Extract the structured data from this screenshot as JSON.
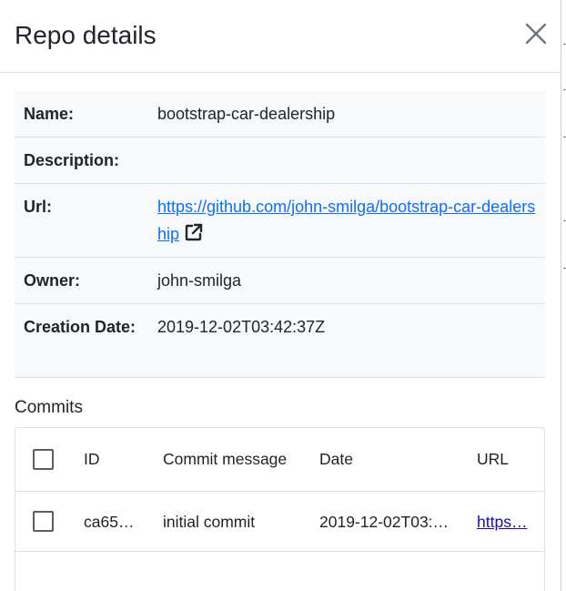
{
  "modal": {
    "title": "Repo details",
    "close_icon": "close-icon"
  },
  "details": {
    "name": {
      "label": "Name:",
      "value": "bootstrap-car-dealership"
    },
    "description": {
      "label": "Description:",
      "value": ""
    },
    "url": {
      "label": "Url:",
      "value": "https://github.com/john-smilga/bootstrap-car-dealership",
      "icon": "external-link-icon"
    },
    "owner": {
      "label": "Owner:",
      "value": "john-smilga"
    },
    "creation_date": {
      "label": "Creation Date:",
      "value": "2019-12-02T03:42:37Z"
    }
  },
  "commits": {
    "title": "Commits",
    "columns": [
      "ID",
      "Commit message",
      "Date",
      "URL"
    ],
    "rows": [
      {
        "id": "ca65…",
        "message": "initial commit",
        "date": "2019-12-02T03:…",
        "url": "https…"
      }
    ]
  },
  "colors": {
    "link": "#0d6efd",
    "grid_link": "#1a0dab",
    "details_bg": "#f8f9fa",
    "border": "#dee2e6"
  }
}
